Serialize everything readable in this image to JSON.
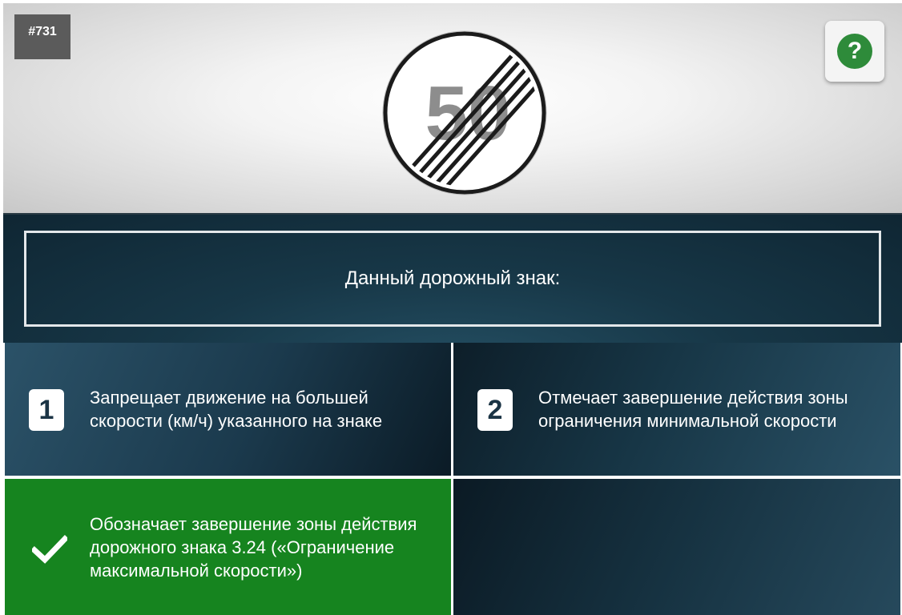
{
  "question": {
    "number": "#731",
    "text": "Данный дорожный знак:",
    "sign_label": "50",
    "help_icon": "question-mark-icon",
    "help_symbol": "?"
  },
  "answers": [
    {
      "badge": "1",
      "text": "Запрещает движение на большей скорости (км/ч) указанного на знаке",
      "state": "default"
    },
    {
      "badge": "2",
      "text": "Отмечает завершение действия зоны ограничения минимальной скорости",
      "state": "default"
    },
    {
      "badge": "",
      "text": "Обозначает завершение зоны действия дорожного знака 3.24 («Ограничение максимальной скорости»)",
      "state": "correct",
      "icon": "checkmark-icon"
    },
    {
      "badge": "",
      "text": "",
      "state": "empty"
    }
  ],
  "colors": {
    "correct": "#16841f",
    "help_green": "#2e8b3a",
    "panel_dark": "#173747"
  }
}
